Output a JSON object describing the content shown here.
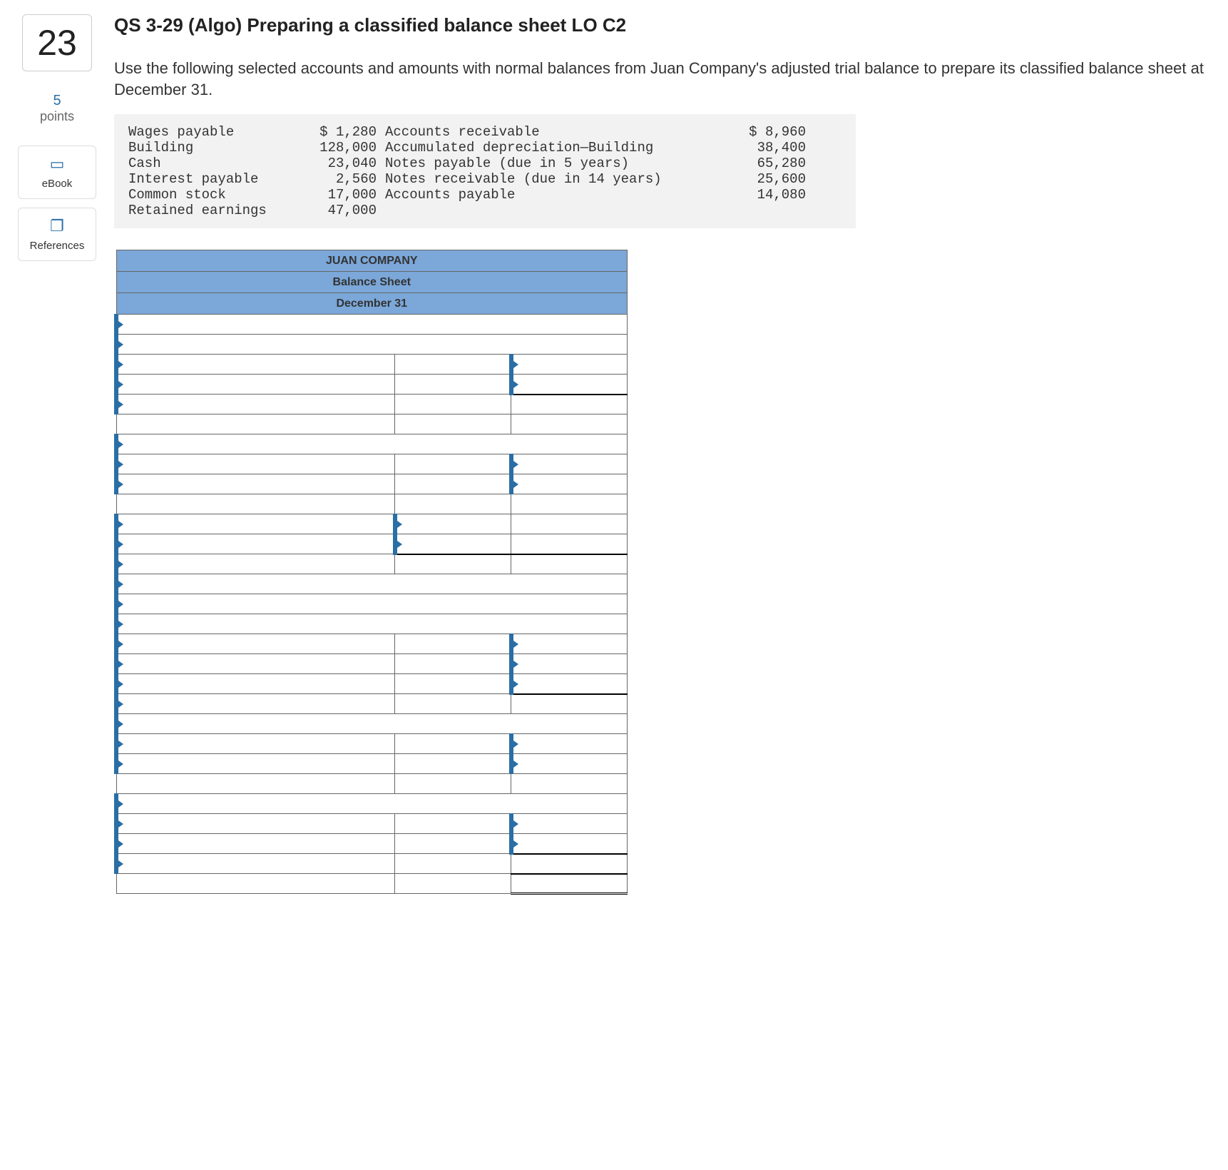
{
  "question": {
    "number": "23",
    "title": "QS 3-29 (Algo) Preparing a classified balance sheet LO C2",
    "points_num": "5",
    "points_label": "points",
    "instructions": "Use the following selected accounts and amounts with normal balances from Juan Company's adjusted trial balance to prepare its classified balance sheet at December 31."
  },
  "sidebar": {
    "ebook": "eBook",
    "references": "References"
  },
  "trial_balance": {
    "rows": [
      {
        "l": "Wages payable",
        "lv": "$ 1,280",
        "r": "Accounts receivable",
        "rv": "$ 8,960"
      },
      {
        "l": "Building",
        "lv": "128,000",
        "r": "Accumulated depreciation—Building",
        "rv": "38,400"
      },
      {
        "l": "Cash",
        "lv": "23,040",
        "r": "Notes payable (due in 5 years)",
        "rv": "65,280"
      },
      {
        "l": "Interest payable",
        "lv": "2,560",
        "r": "Notes receivable (due in 14 years)",
        "rv": "25,600"
      },
      {
        "l": "Common stock",
        "lv": "17,000",
        "r": "Accounts payable",
        "rv": "14,080"
      },
      {
        "l": "Retained earnings",
        "lv": "47,000",
        "r": "",
        "rv": ""
      }
    ]
  },
  "balance_sheet": {
    "company": "JUAN COMPANY",
    "title": "Balance Sheet",
    "date": "December 31"
  }
}
